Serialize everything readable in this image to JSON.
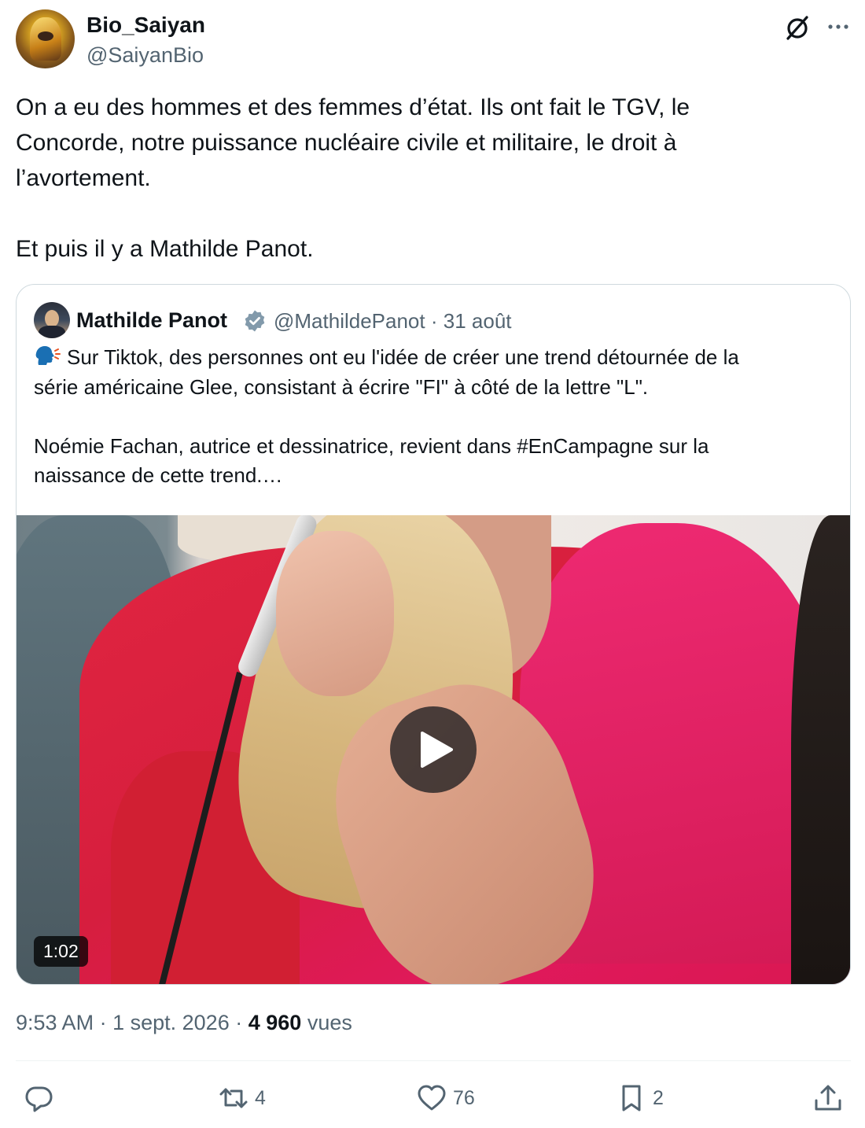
{
  "author": {
    "display_name": "Bio_Saiyan",
    "handle": "@SaiyanBio",
    "avatar_icon": "avatar-image"
  },
  "header_icons": {
    "grok": "grok-icon",
    "more": "more-icon"
  },
  "tweet": {
    "text": "On a eu des hommes et des femmes d’état. Ils ont fait le TGV, le\nConcorde, notre puissance nucléaire civile et militaire, le droit à\nl’avortement.\n\nEt puis il y a Mathilde Panot."
  },
  "quote": {
    "display_name": "Mathilde Panot",
    "verified_icon": "verified-badge-icon",
    "handle": "@MathildePanot",
    "separator": "·",
    "date": "31 août",
    "text": "Sur Tiktok, des personnes ont eu l'idée de créer une trend détournée de la\nsérie américaine Glee, consistant à écrire \"FI\" à côté de la lettre \"L\".\n\nNoémie Fachan, autrice et dessinatrice, revient dans #EnCampagne sur la\nnaissance de cette trend.…",
    "video": {
      "duration": "1:02",
      "play_icon": "play-icon"
    }
  },
  "meta": {
    "time": "9:53 AM",
    "sep1": "·",
    "date": "1 sept. 2026",
    "sep2": "·",
    "views_count": "4 960",
    "views_label": "vues"
  },
  "actions": {
    "reply": {
      "icon": "reply-icon",
      "count": ""
    },
    "repost": {
      "icon": "repost-icon",
      "count": "4"
    },
    "like": {
      "icon": "like-icon",
      "count": "76"
    },
    "bookmark": {
      "icon": "bookmark-icon",
      "count": "2"
    },
    "share": {
      "icon": "share-icon"
    }
  },
  "colors": {
    "text_primary": "#0f1419",
    "text_secondary": "#536471",
    "border": "#cfd9de",
    "verified": "#829aab"
  }
}
